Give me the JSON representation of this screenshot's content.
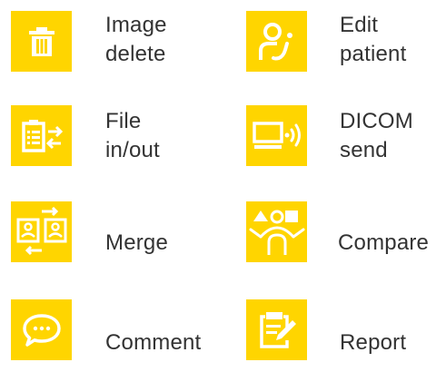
{
  "theme": {
    "tile_color": "#FFD500",
    "icon_color": "#FFFFFF",
    "text_color": "#333333"
  },
  "actions": {
    "image_delete": {
      "line1": "Image",
      "line2": "delete",
      "icon": "trash-icon"
    },
    "edit_patient": {
      "line1": "Edit",
      "line2": "patient",
      "icon": "person-edit-icon"
    },
    "file_in_out": {
      "line1": "File",
      "line2": "in/out",
      "icon": "file-transfer-icon"
    },
    "dicom_send": {
      "line1": "DICOM",
      "line2": "send",
      "icon": "monitor-send-icon"
    },
    "merge": {
      "label": "Merge",
      "icon": "merge-icon"
    },
    "compare": {
      "label": "Compare",
      "icon": "compare-icon"
    },
    "comment": {
      "label": "Comment",
      "icon": "speech-bubble-icon"
    },
    "report": {
      "label": "Report",
      "icon": "clipboard-pen-icon"
    }
  }
}
